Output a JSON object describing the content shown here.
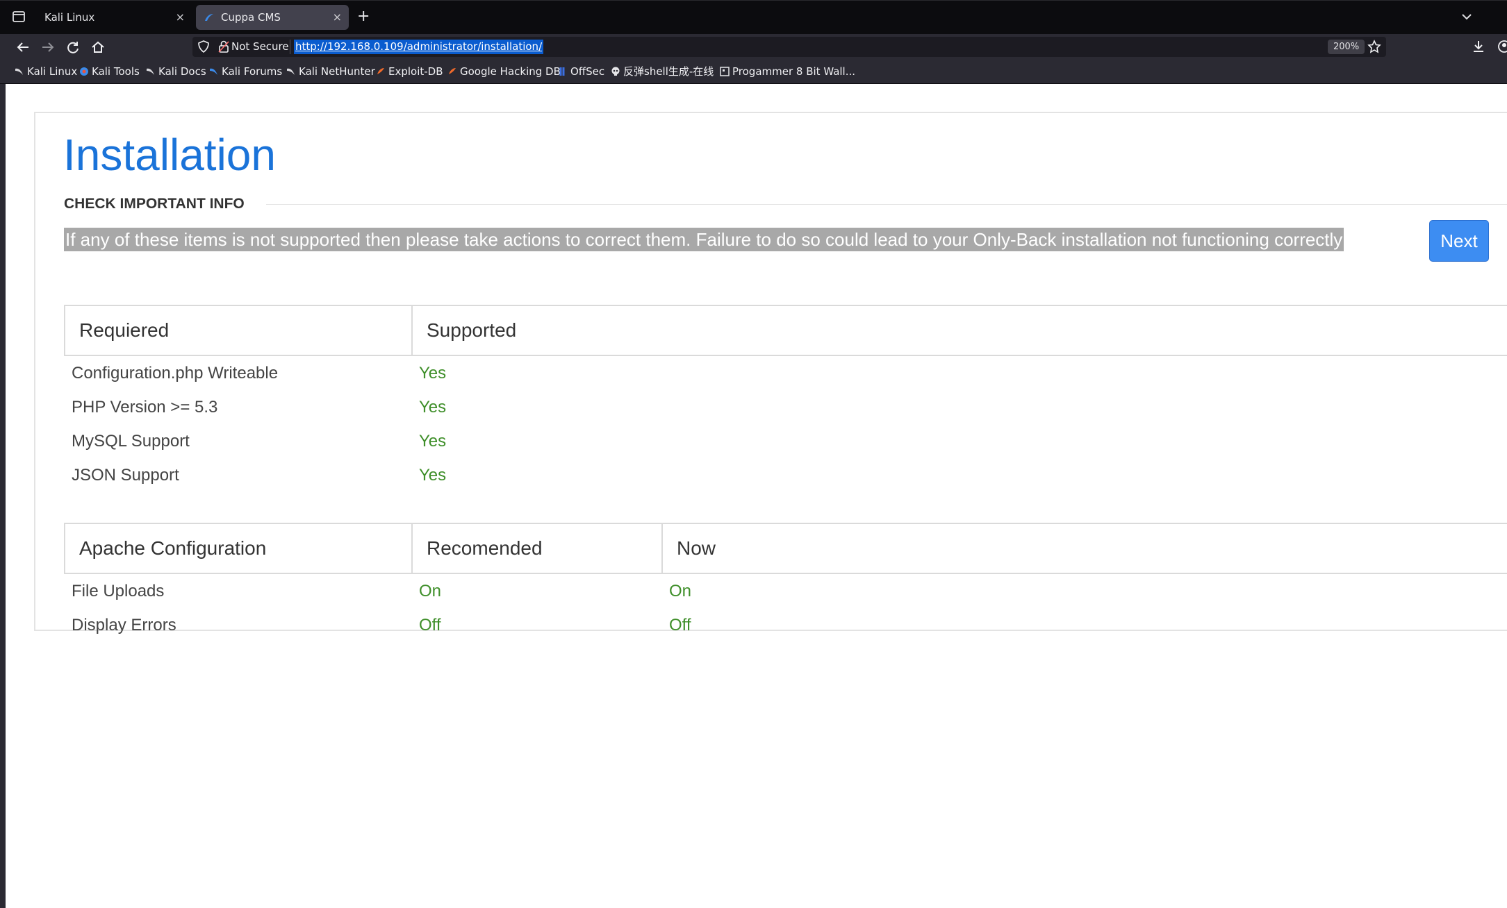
{
  "browser": {
    "tabs": [
      {
        "label": "Kali Linux",
        "active": false
      },
      {
        "label": "Cuppa CMS",
        "active": true
      }
    ],
    "close_glyph": "×",
    "new_tab_glyph": "+",
    "address": {
      "security_label": "Not Secure",
      "url": "http://192.168.0.109/administrator/installation/",
      "zoom": "200%"
    },
    "bookmarks": [
      {
        "label": "Kali Linux",
        "icon": "kali-dragon-icon"
      },
      {
        "label": "Kali Tools",
        "icon": "kali-tools-icon"
      },
      {
        "label": "Kali Docs",
        "icon": "kali-dragon-icon"
      },
      {
        "label": "Kali Forums",
        "icon": "kali-forums-icon"
      },
      {
        "label": "Kali NetHunter",
        "icon": "kali-dragon-icon"
      },
      {
        "label": "Exploit-DB",
        "icon": "exploit-db-icon"
      },
      {
        "label": "Google Hacking DB",
        "icon": "exploit-db-icon"
      },
      {
        "label": "OffSec",
        "icon": "offsec-icon"
      },
      {
        "label": "反弹shell生成-在线",
        "icon": "skull-icon"
      },
      {
        "label": "Progammer 8 Bit Wall...",
        "icon": "wallpaper-icon"
      }
    ]
  },
  "installation": {
    "title": "Installation",
    "section_heading": "CHECK IMPORTANT INFO",
    "warning": "If any of these items is not supported then please take actions to correct them. Failure to do so could lead to your Only-Back installation not functioning correctly",
    "next_label": "Next",
    "requirements": {
      "headers": [
        "Requiered",
        "Supported"
      ],
      "rows": [
        [
          "Configuration.php Writeable",
          "Yes"
        ],
        [
          "PHP Version >= 5.3",
          "Yes"
        ],
        [
          "MySQL Support",
          "Yes"
        ],
        [
          "JSON Support",
          "Yes"
        ]
      ]
    },
    "apache": {
      "headers": [
        "Apache Configuration",
        "Recomended",
        "Now"
      ],
      "rows": [
        [
          "File Uploads",
          "On",
          "On"
        ],
        [
          "Display Errors",
          "Off",
          "Off"
        ]
      ]
    }
  },
  "colors": {
    "title_blue": "#1a73d9",
    "ok_green": "#3f8f2a",
    "button_blue": "#3d8df2",
    "url_highlight": "#0a5ccf"
  }
}
